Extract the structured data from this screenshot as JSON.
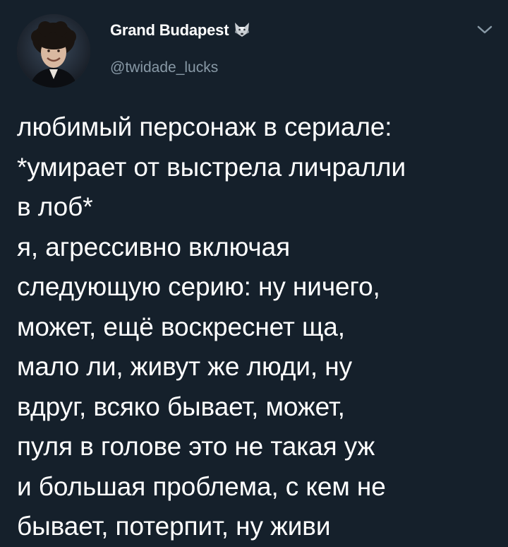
{
  "tweet": {
    "author": {
      "display_name": "Grand Budapest",
      "name_emoji": "wolf-face-icon",
      "handle": "@twidade_lucks"
    },
    "menu_icon": "chevron-down-icon",
    "lines": [
      "любимый персонаж в сериале:",
      "*умирает от выстрела личралли",
      "в лоб*",
      "я, агрессивно включая",
      "следующую серию: ну ничего,",
      "может, ещё воскреснет ща,",
      "мало ли, живут же люди, ну",
      "вдруг, всяко бывает, может,",
      "пуля в голове это не такая уж",
      "и большая проблема, с кем не",
      "бывает, потерпит, ну живи"
    ]
  },
  "colors": {
    "background": "#15202b",
    "text_primary": "#ffffff",
    "text_secondary": "#8899a6"
  }
}
